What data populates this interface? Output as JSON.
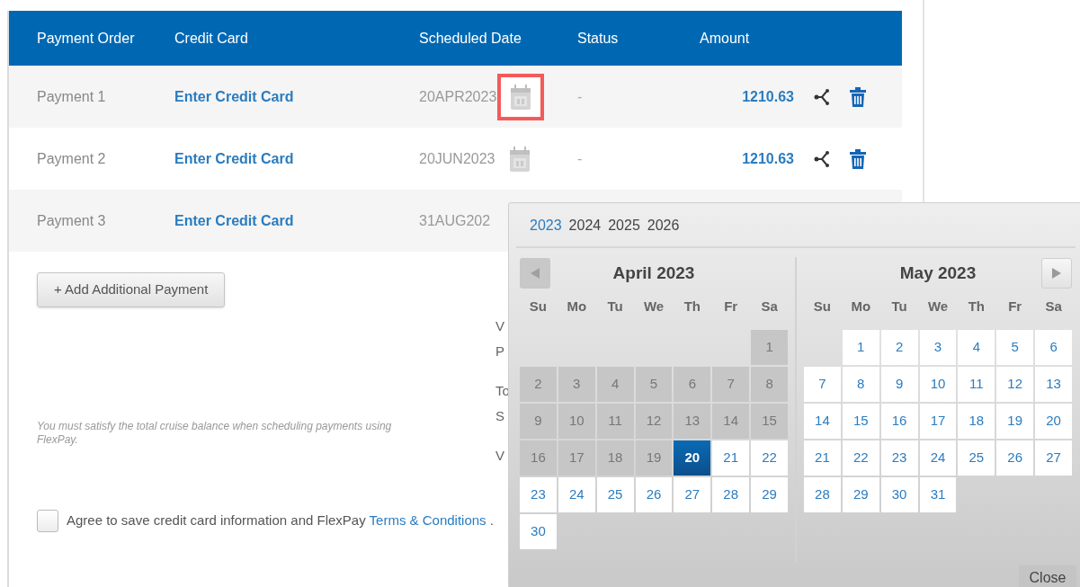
{
  "table": {
    "columns": [
      "Payment Order",
      "Credit Card",
      "Scheduled Date",
      "Status",
      "Amount"
    ],
    "rows": [
      {
        "payment": "Payment 1",
        "card": "Enter Credit Card",
        "date": "20APR2023",
        "status": "-",
        "amount": "1210.63",
        "highlighted": true
      },
      {
        "payment": "Payment 2",
        "card": "Enter Credit Card",
        "date": "20JUN2023",
        "status": "-",
        "amount": "1210.63",
        "highlighted": false
      },
      {
        "payment": "Payment 3",
        "card": "Enter Credit Card",
        "date": "31AUG202"
      }
    ]
  },
  "add_button": "+ Add Additional Payment",
  "note": "You must satisfy the total cruise balance when scheduling payments using FlexPay.",
  "summary_fragments": [
    "V",
    "P",
    "To",
    "S",
    "V"
  ],
  "agree": {
    "checked": false,
    "text": "Agree to save credit card information and FlexPay",
    "link": "Terms & Conditions",
    "tail": "."
  },
  "datepicker": {
    "years": [
      {
        "label": "2023",
        "selected": true
      },
      {
        "label": "2024",
        "selected": false
      },
      {
        "label": "2025",
        "selected": false
      },
      {
        "label": "2026",
        "selected": false
      }
    ],
    "months": [
      {
        "title": "April 2023",
        "kind": "leading",
        "weekdays": [
          "Su",
          "Mo",
          "Tu",
          "We",
          "Th",
          "Fr",
          "Sa"
        ],
        "weeks": [
          [
            {
              "day": "1",
              "disabled": true,
              "selected": false
            }
          ],
          [
            {
              "day": "2",
              "disabled": true,
              "selected": false
            },
            {
              "day": "3",
              "disabled": true,
              "selected": false
            },
            {
              "day": "4",
              "disabled": true,
              "selected": false
            },
            {
              "day": "5",
              "disabled": true,
              "selected": false
            },
            {
              "day": "6",
              "disabled": true,
              "selected": false
            },
            {
              "day": "7",
              "disabled": true,
              "selected": false
            },
            {
              "day": "8",
              "disabled": true,
              "selected": false
            }
          ],
          [
            {
              "day": "9",
              "disabled": true,
              "selected": false
            },
            {
              "day": "10",
              "disabled": true,
              "selected": false
            },
            {
              "day": "11",
              "disabled": true,
              "selected": false
            },
            {
              "day": "12",
              "disabled": true,
              "selected": false
            },
            {
              "day": "13",
              "disabled": true,
              "selected": false
            },
            {
              "day": "14",
              "disabled": true,
              "selected": false
            },
            {
              "day": "15",
              "disabled": true,
              "selected": false
            }
          ],
          [
            {
              "day": "16",
              "disabled": true,
              "selected": false
            },
            {
              "day": "17",
              "disabled": true,
              "selected": false
            },
            {
              "day": "18",
              "disabled": true,
              "selected": false
            },
            {
              "day": "19",
              "disabled": true,
              "selected": false
            },
            {
              "day": "20",
              "disabled": false,
              "selected": true
            },
            {
              "day": "21",
              "disabled": false,
              "selected": false
            },
            {
              "day": "22",
              "disabled": false,
              "selected": false
            }
          ],
          [
            {
              "day": "23",
              "disabled": false,
              "selected": false
            },
            {
              "day": "24",
              "disabled": false,
              "selected": false
            },
            {
              "day": "25",
              "disabled": false,
              "selected": false
            },
            {
              "day": "26",
              "disabled": false,
              "selected": false
            },
            {
              "day": "27",
              "disabled": false,
              "selected": false
            },
            {
              "day": "28",
              "disabled": false,
              "selected": false
            },
            {
              "day": "29",
              "disabled": false,
              "selected": false
            }
          ],
          [
            {
              "day": "30",
              "disabled": false,
              "selected": false
            }
          ]
        ]
      },
      {
        "title": "May 2023",
        "kind": "trailing",
        "weekdays": [
          "Su",
          "Mo",
          "Tu",
          "We",
          "Th",
          "Fr",
          "Sa"
        ],
        "weeks": [
          [
            {
              "day": "1",
              "disabled": false,
              "selected": false
            },
            {
              "day": "2",
              "disabled": false,
              "selected": false
            },
            {
              "day": "3",
              "disabled": false,
              "selected": false
            },
            {
              "day": "4",
              "disabled": false,
              "selected": false
            },
            {
              "day": "5",
              "disabled": false,
              "selected": false
            },
            {
              "day": "6",
              "disabled": false,
              "selected": false
            }
          ],
          [
            {
              "day": "7",
              "disabled": false,
              "selected": false
            },
            {
              "day": "8",
              "disabled": false,
              "selected": false
            },
            {
              "day": "9",
              "disabled": false,
              "selected": false
            },
            {
              "day": "10",
              "disabled": false,
              "selected": false
            },
            {
              "day": "11",
              "disabled": false,
              "selected": false
            },
            {
              "day": "12",
              "disabled": false,
              "selected": false
            },
            {
              "day": "13",
              "disabled": false,
              "selected": false
            }
          ],
          [
            {
              "day": "14",
              "disabled": false,
              "selected": false
            },
            {
              "day": "15",
              "disabled": false,
              "selected": false
            },
            {
              "day": "16",
              "disabled": false,
              "selected": false
            },
            {
              "day": "17",
              "disabled": false,
              "selected": false
            },
            {
              "day": "18",
              "disabled": false,
              "selected": false
            },
            {
              "day": "19",
              "disabled": false,
              "selected": false
            },
            {
              "day": "20",
              "disabled": false,
              "selected": false
            }
          ],
          [
            {
              "day": "21",
              "disabled": false,
              "selected": false
            },
            {
              "day": "22",
              "disabled": false,
              "selected": false
            },
            {
              "day": "23",
              "disabled": false,
              "selected": false
            },
            {
              "day": "24",
              "disabled": false,
              "selected": false
            },
            {
              "day": "25",
              "disabled": false,
              "selected": false
            },
            {
              "day": "26",
              "disabled": false,
              "selected": false
            },
            {
              "day": "27",
              "disabled": false,
              "selected": false
            }
          ],
          [
            {
              "day": "28",
              "disabled": false,
              "selected": false
            },
            {
              "day": "29",
              "disabled": false,
              "selected": false
            },
            {
              "day": "30",
              "disabled": false,
              "selected": false
            },
            {
              "day": "31",
              "disabled": false,
              "selected": false
            }
          ]
        ]
      }
    ],
    "close": "Close"
  }
}
